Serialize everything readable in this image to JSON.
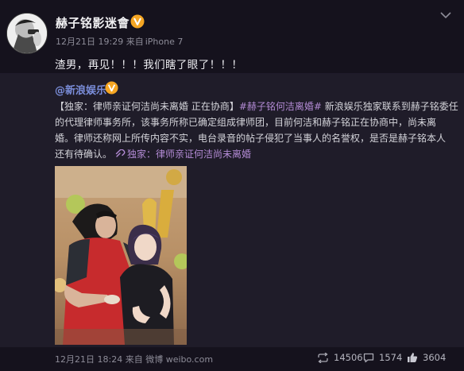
{
  "post": {
    "author": "赫子铭影迷會",
    "time": "12月21日 19:29",
    "source_prefix": "来自",
    "source": "iPhone 7",
    "text": "渣男，再见！！！我们瞎了眼了！！！"
  },
  "repost": {
    "author": "@新浪娱乐",
    "line1_prefix": "【独家：律师亲证何洁尚未离婚 正在协商】",
    "line1_hashtag": "#赫子铭何洁离婚#",
    "line1_suffix": " 新浪娱乐独家联系到赫子铭委任",
    "line2": "的代理律师事务所，该事务所称已确定组成律师团，目前何洁和赫子铭正在协商中，尚未离",
    "line3": "婚。律师还称网上所传内容不实，电台录音的帖子侵犯了当事人的名誉权，是否是赫子铭本人",
    "line4_prefix": "还有待确认。",
    "line4_link": "独家：律师亲证何洁尚未离婚",
    "footer_time": "12月21日 18:24",
    "footer_source_prefix": "来自",
    "footer_source": "微博 weibo.com",
    "reposts": "14506",
    "comments": "1574",
    "likes": "3604"
  },
  "colors": {
    "background": "#15121d",
    "repost_background": "#1f1c29",
    "link": "#b38bd5",
    "author_link": "#7a8dd9",
    "verified_badge": "#f5a623"
  },
  "icons": [
    "verified-badge-icon",
    "chevron-down-icon",
    "link-icon",
    "repost-icon",
    "comment-icon",
    "like-icon"
  ]
}
